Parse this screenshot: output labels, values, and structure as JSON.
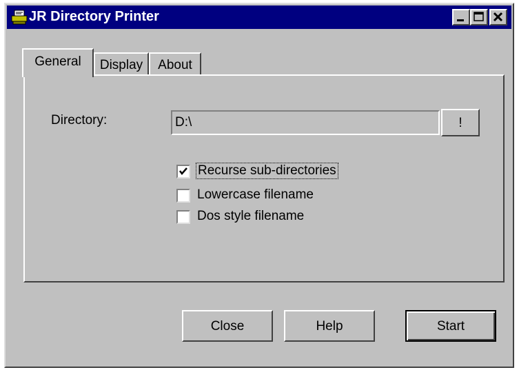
{
  "window": {
    "title": "JR Directory Printer",
    "icon": "printer-icon",
    "controls": [
      "minimize-icon",
      "maximize-icon",
      "close-icon"
    ]
  },
  "tabs": [
    {
      "label": "General",
      "selected": true
    },
    {
      "label": "Display",
      "selected": false
    },
    {
      "label": "About",
      "selected": false
    }
  ],
  "general": {
    "directory_label": "Directory:",
    "directory_value": "D:\\",
    "browse_label": "!",
    "options": [
      {
        "label": "Recurse sub-directories",
        "checked": true
      },
      {
        "label": "Lowercase filename",
        "checked": false
      },
      {
        "label": "Dos style filename",
        "checked": false
      }
    ]
  },
  "buttons": {
    "close": "Close",
    "help": "Help",
    "start": "Start"
  },
  "colors": {
    "titlebar": "#000080",
    "face": "#c0c0c0"
  }
}
